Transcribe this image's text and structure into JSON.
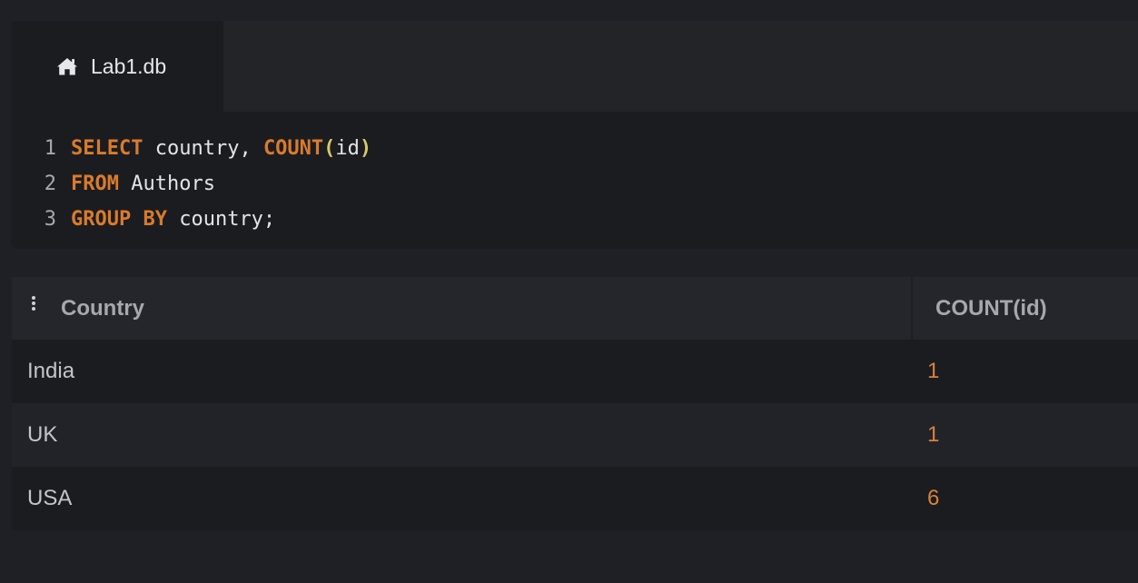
{
  "tab": {
    "icon": "home-icon",
    "label": "Lab1.db"
  },
  "editor": {
    "lines": [
      {
        "number": "1",
        "tokens": [
          {
            "text": "SELECT",
            "kind": "keyword"
          },
          {
            "text": " country, ",
            "kind": "plain"
          },
          {
            "text": "COUNT",
            "kind": "function"
          },
          {
            "text": "(",
            "kind": "paren"
          },
          {
            "text": "id",
            "kind": "plain"
          },
          {
            "text": ")",
            "kind": "paren"
          }
        ]
      },
      {
        "number": "2",
        "tokens": [
          {
            "text": "FROM",
            "kind": "keyword"
          },
          {
            "text": " Authors",
            "kind": "plain"
          }
        ]
      },
      {
        "number": "3",
        "tokens": [
          {
            "text": "GROUP BY",
            "kind": "keyword"
          },
          {
            "text": " country;",
            "kind": "plain"
          }
        ]
      }
    ]
  },
  "results": {
    "column_menu_icon": "vertical-dots-icon",
    "columns": [
      "Country",
      "COUNT(id)"
    ],
    "rows": [
      {
        "country": "India",
        "count": "1"
      },
      {
        "country": "UK",
        "count": "1"
      },
      {
        "country": "USA",
        "count": "6"
      }
    ]
  },
  "colors": {
    "keyword": "#d97b2d",
    "paren": "#d8c86a",
    "count_value": "#d9823a",
    "background": "#1f2025"
  }
}
